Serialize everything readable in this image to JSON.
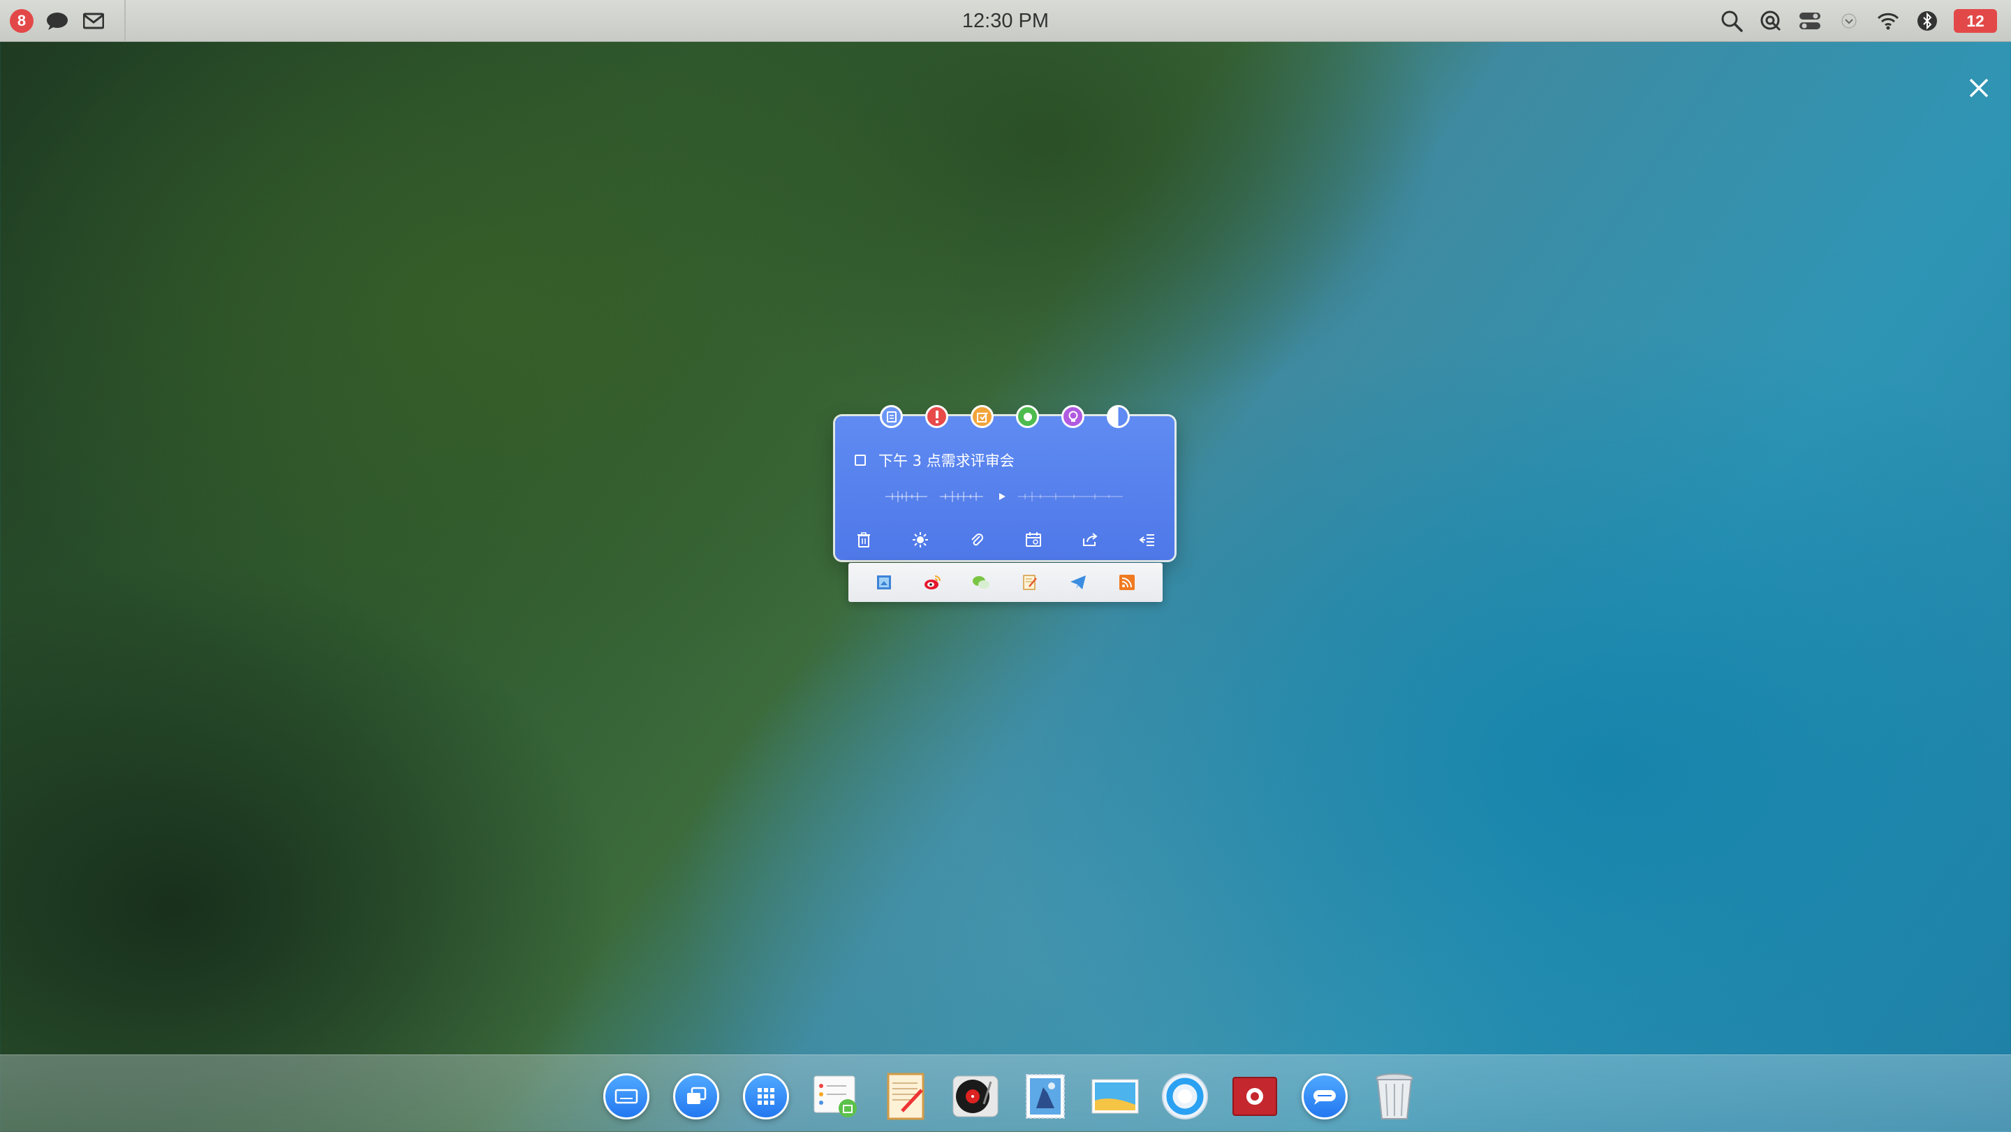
{
  "menubar": {
    "notification_badge": "8",
    "clock": "12:30 PM",
    "message_count": "12",
    "left_icons": [
      "chat-icon",
      "mail-icon"
    ],
    "right_icons": [
      "search-icon",
      "spotlight-icon",
      "control-center-icon",
      "chevron-down-icon",
      "wifi-icon",
      "bluetooth-icon"
    ]
  },
  "note": {
    "tags": [
      {
        "name": "note-tag",
        "color": "#6d96f4"
      },
      {
        "name": "important-tag",
        "color": "#e84a4a"
      },
      {
        "name": "todo-tag",
        "color": "#f2a43a"
      },
      {
        "name": "done-tag",
        "color": "#4dbb4d"
      },
      {
        "name": "idea-tag",
        "color": "#b05be0"
      },
      {
        "name": "theme-tag",
        "color": "#ffffff"
      }
    ],
    "item_text": "下午 3 点需求评审会",
    "toolbar": [
      "trash-icon",
      "brightness-icon",
      "attachment-icon",
      "calendar-icon",
      "share-icon",
      "collapse-icon"
    ]
  },
  "share_targets": [
    "email-share-icon",
    "weibo-icon",
    "wechat-icon",
    "notes-icon",
    "telegram-icon",
    "rss-icon"
  ],
  "dock": {
    "items": [
      "keyboard-app",
      "windows-app",
      "launcher-app",
      "calendar-app",
      "notes-app",
      "music-app",
      "photos-app",
      "gallery-app",
      "browser-app",
      "dictionary-app",
      "messages-app",
      "trash-app"
    ]
  },
  "colors": {
    "accent": "#5582ee",
    "badge": "#e34848"
  }
}
